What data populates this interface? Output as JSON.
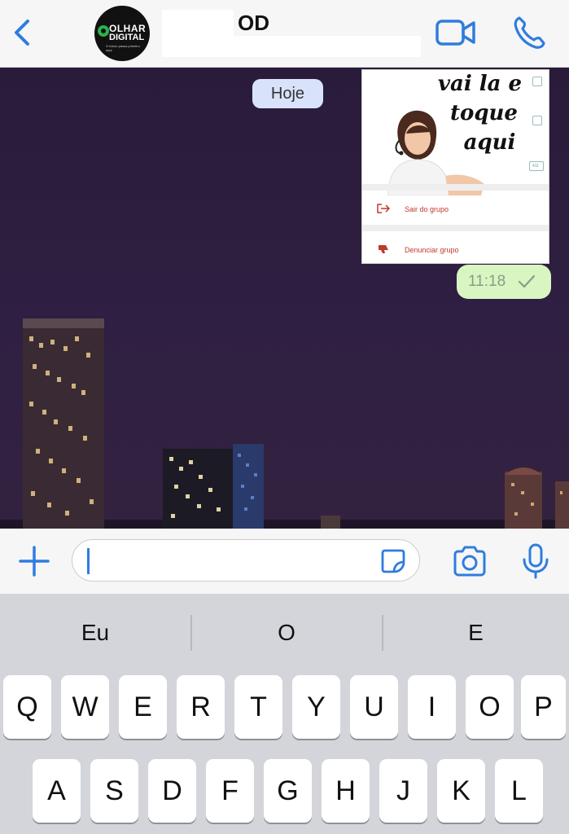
{
  "header": {
    "title": "OD",
    "avatar_line1": "OLHAR",
    "avatar_line2": "DIGITAL",
    "avatar_tagline": "O futuro passa primeiro aqui"
  },
  "chat": {
    "date_label": "Hoje",
    "image_message": {
      "line1": "vai la e",
      "line2": "toque",
      "line3": "aqui",
      "option1": "Sair do grupo",
      "option2": "Denunciar grupo",
      "badge": "411"
    },
    "time": "11:18"
  },
  "input": {
    "value": "",
    "placeholder": ""
  },
  "keyboard": {
    "suggestions": [
      "Eu",
      "O",
      "E"
    ],
    "row1": [
      "Q",
      "W",
      "E",
      "R",
      "T",
      "Y",
      "U",
      "I",
      "O",
      "P"
    ],
    "row2": [
      "A",
      "S",
      "D",
      "F",
      "G",
      "H",
      "J",
      "K",
      "L"
    ]
  },
  "colors": {
    "accent": "#2f7dde",
    "outgoing_bubble": "#d8f5c2",
    "date_pill": "#d9e2fb",
    "chat_background": "#2a1b3a"
  }
}
